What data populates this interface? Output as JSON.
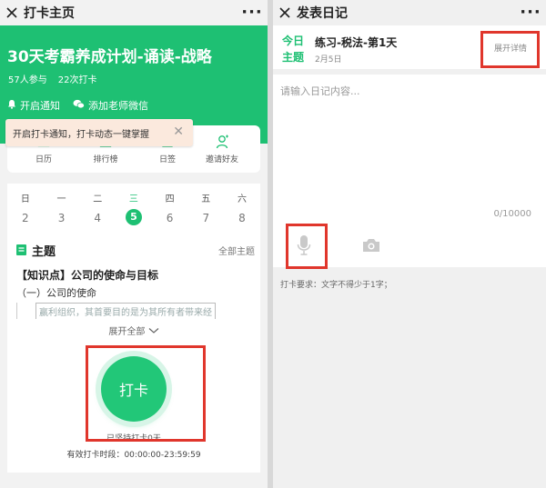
{
  "left": {
    "titlebar": {
      "title": "打卡主页",
      "more": "···"
    },
    "plan": {
      "title": "30天考霸养成计划-诵读-战略",
      "participants": "57人参与",
      "checkins": "22次打卡"
    },
    "header_links": {
      "notify": "开启通知",
      "wechat": "添加老师微信"
    },
    "tooltip": {
      "text": "开启打卡通知，打卡动态一键掌握"
    },
    "nav": [
      {
        "label": "日历"
      },
      {
        "label": "排行榜"
      },
      {
        "label": "日签"
      },
      {
        "label": "邀请好友"
      }
    ],
    "calendar": {
      "weekdays": [
        "日",
        "一",
        "二",
        "三",
        "四",
        "五",
        "六"
      ],
      "dates": [
        "2",
        "3",
        "4",
        "5",
        "6",
        "7",
        "8"
      ],
      "today_index": 3
    },
    "topic": {
      "section_title": "主题",
      "all_topics": "全部主题",
      "title": "【知识点】公司的使命与目标",
      "subtitle": "（一）公司的使命",
      "preview": "赢利组织，其首要目的是为其所有者带来经",
      "expand": "展开全部"
    },
    "checkin": {
      "button": "打卡",
      "persist": "已坚持打卡0天",
      "period": "有效打卡时段：00:00:00-23:59:59"
    }
  },
  "right": {
    "titlebar": {
      "title": "发表日记",
      "more": "···"
    },
    "info": {
      "badge_line1": "今日",
      "badge_line2": "主题",
      "title": "练习-税法-第1天",
      "date": "2月5日",
      "details": "展开详情"
    },
    "editor": {
      "placeholder": "请输入日记内容...",
      "count": "0/10000"
    },
    "requirement": "打卡要求：文字不得少于1字；"
  },
  "colors": {
    "accent": "#1ec073",
    "highlight": "#e0362c"
  }
}
